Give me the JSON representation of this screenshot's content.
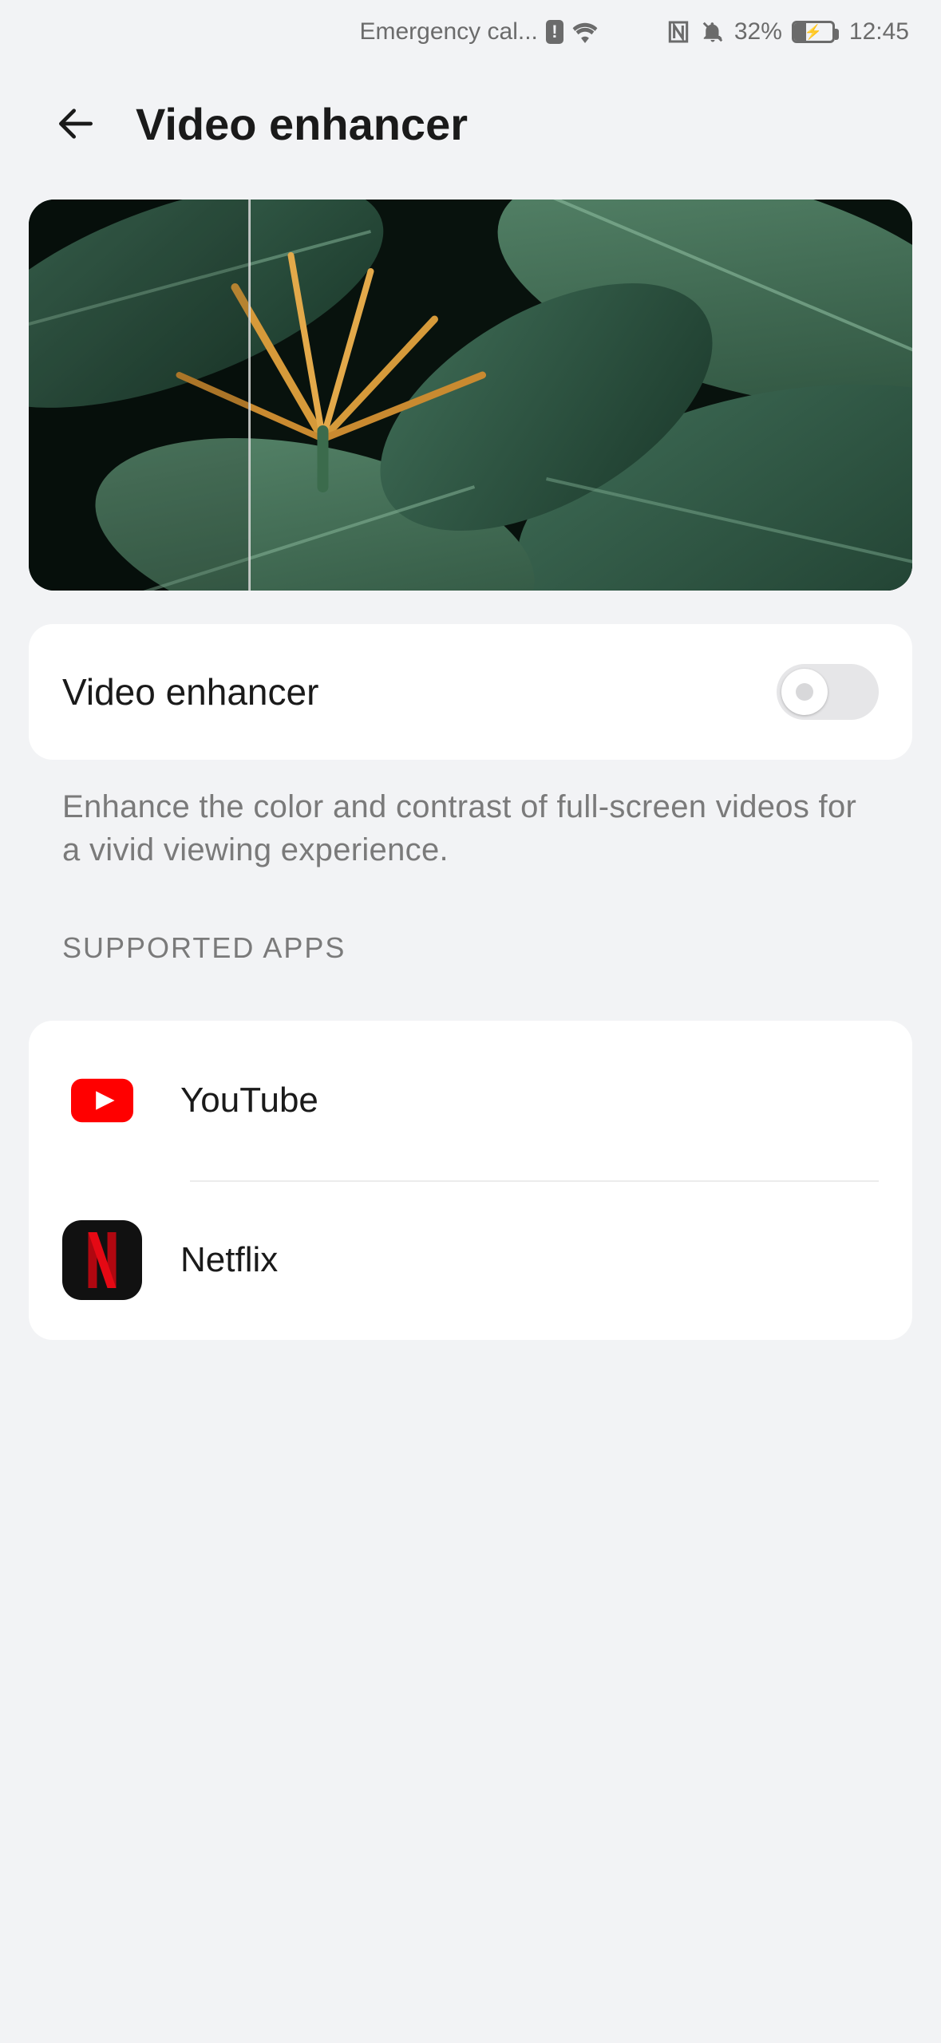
{
  "status_bar": {
    "carrier_text": "Emergency cal...",
    "battery_percent": "32%",
    "time": "12:45"
  },
  "header": {
    "title": "Video enhancer"
  },
  "main": {
    "toggle": {
      "label": "Video enhancer",
      "enabled": false
    },
    "description": "Enhance the color and contrast of full-screen videos for a vivid viewing experience.",
    "section_header": "SUPPORTED APPS",
    "apps": [
      {
        "name": "YouTube",
        "icon": "youtube"
      },
      {
        "name": "Netflix",
        "icon": "netflix"
      }
    ]
  }
}
